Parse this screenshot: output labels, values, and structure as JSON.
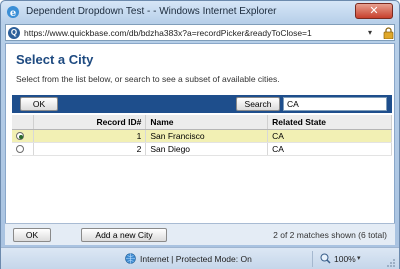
{
  "window": {
    "title": "Dependent Dropdown Test - - Windows Internet Explorer",
    "close_label": "✕"
  },
  "address": {
    "url": "https://www.quickbase.com/db/bdzha383x?a=recordPicker&readyToClose=1",
    "icon_letter": "Q"
  },
  "dialog": {
    "title": "Select a City",
    "instructions": "Select from the list below, or search to see a subset of available cities."
  },
  "toolbar": {
    "ok_label": "OK",
    "search_label": "Search",
    "search_value": "CA"
  },
  "table": {
    "columns": [
      "",
      "Record ID#",
      "Name",
      "Related State"
    ],
    "rows": [
      {
        "selected": true,
        "record_id": "1",
        "name": "San Francisco",
        "state": "CA"
      },
      {
        "selected": false,
        "record_id": "2",
        "name": "San Diego",
        "state": "CA"
      }
    ]
  },
  "footer": {
    "ok_label": "OK",
    "add_label": "Add a new City",
    "match_text": "2 of 2 matches shown (6 total)"
  },
  "statusbar": {
    "zone_text": "Internet | Protected Mode: On",
    "zoom": "100%"
  },
  "colors": {
    "toolbar": "#1e4e8c",
    "title": "#1e4a80",
    "selected_row": "#f2f0b4"
  }
}
